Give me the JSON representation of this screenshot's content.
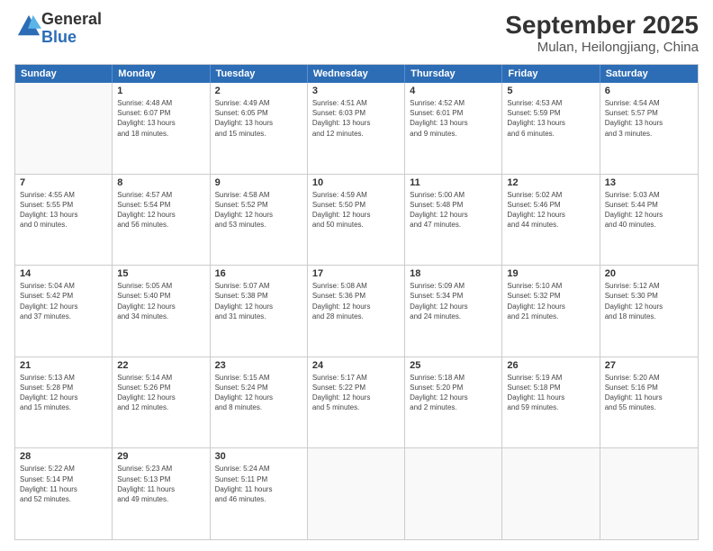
{
  "logo": {
    "general": "General",
    "blue": "Blue"
  },
  "header": {
    "month": "September 2025",
    "location": "Mulan, Heilongjiang, China"
  },
  "days": [
    "Sunday",
    "Monday",
    "Tuesday",
    "Wednesday",
    "Thursday",
    "Friday",
    "Saturday"
  ],
  "weeks": [
    [
      {
        "day": "",
        "info": ""
      },
      {
        "day": "1",
        "info": "Sunrise: 4:48 AM\nSunset: 6:07 PM\nDaylight: 13 hours\nand 18 minutes."
      },
      {
        "day": "2",
        "info": "Sunrise: 4:49 AM\nSunset: 6:05 PM\nDaylight: 13 hours\nand 15 minutes."
      },
      {
        "day": "3",
        "info": "Sunrise: 4:51 AM\nSunset: 6:03 PM\nDaylight: 13 hours\nand 12 minutes."
      },
      {
        "day": "4",
        "info": "Sunrise: 4:52 AM\nSunset: 6:01 PM\nDaylight: 13 hours\nand 9 minutes."
      },
      {
        "day": "5",
        "info": "Sunrise: 4:53 AM\nSunset: 5:59 PM\nDaylight: 13 hours\nand 6 minutes."
      },
      {
        "day": "6",
        "info": "Sunrise: 4:54 AM\nSunset: 5:57 PM\nDaylight: 13 hours\nand 3 minutes."
      }
    ],
    [
      {
        "day": "7",
        "info": "Sunrise: 4:55 AM\nSunset: 5:55 PM\nDaylight: 13 hours\nand 0 minutes."
      },
      {
        "day": "8",
        "info": "Sunrise: 4:57 AM\nSunset: 5:54 PM\nDaylight: 12 hours\nand 56 minutes."
      },
      {
        "day": "9",
        "info": "Sunrise: 4:58 AM\nSunset: 5:52 PM\nDaylight: 12 hours\nand 53 minutes."
      },
      {
        "day": "10",
        "info": "Sunrise: 4:59 AM\nSunset: 5:50 PM\nDaylight: 12 hours\nand 50 minutes."
      },
      {
        "day": "11",
        "info": "Sunrise: 5:00 AM\nSunset: 5:48 PM\nDaylight: 12 hours\nand 47 minutes."
      },
      {
        "day": "12",
        "info": "Sunrise: 5:02 AM\nSunset: 5:46 PM\nDaylight: 12 hours\nand 44 minutes."
      },
      {
        "day": "13",
        "info": "Sunrise: 5:03 AM\nSunset: 5:44 PM\nDaylight: 12 hours\nand 40 minutes."
      }
    ],
    [
      {
        "day": "14",
        "info": "Sunrise: 5:04 AM\nSunset: 5:42 PM\nDaylight: 12 hours\nand 37 minutes."
      },
      {
        "day": "15",
        "info": "Sunrise: 5:05 AM\nSunset: 5:40 PM\nDaylight: 12 hours\nand 34 minutes."
      },
      {
        "day": "16",
        "info": "Sunrise: 5:07 AM\nSunset: 5:38 PM\nDaylight: 12 hours\nand 31 minutes."
      },
      {
        "day": "17",
        "info": "Sunrise: 5:08 AM\nSunset: 5:36 PM\nDaylight: 12 hours\nand 28 minutes."
      },
      {
        "day": "18",
        "info": "Sunrise: 5:09 AM\nSunset: 5:34 PM\nDaylight: 12 hours\nand 24 minutes."
      },
      {
        "day": "19",
        "info": "Sunrise: 5:10 AM\nSunset: 5:32 PM\nDaylight: 12 hours\nand 21 minutes."
      },
      {
        "day": "20",
        "info": "Sunrise: 5:12 AM\nSunset: 5:30 PM\nDaylight: 12 hours\nand 18 minutes."
      }
    ],
    [
      {
        "day": "21",
        "info": "Sunrise: 5:13 AM\nSunset: 5:28 PM\nDaylight: 12 hours\nand 15 minutes."
      },
      {
        "day": "22",
        "info": "Sunrise: 5:14 AM\nSunset: 5:26 PM\nDaylight: 12 hours\nand 12 minutes."
      },
      {
        "day": "23",
        "info": "Sunrise: 5:15 AM\nSunset: 5:24 PM\nDaylight: 12 hours\nand 8 minutes."
      },
      {
        "day": "24",
        "info": "Sunrise: 5:17 AM\nSunset: 5:22 PM\nDaylight: 12 hours\nand 5 minutes."
      },
      {
        "day": "25",
        "info": "Sunrise: 5:18 AM\nSunset: 5:20 PM\nDaylight: 12 hours\nand 2 minutes."
      },
      {
        "day": "26",
        "info": "Sunrise: 5:19 AM\nSunset: 5:18 PM\nDaylight: 11 hours\nand 59 minutes."
      },
      {
        "day": "27",
        "info": "Sunrise: 5:20 AM\nSunset: 5:16 PM\nDaylight: 11 hours\nand 55 minutes."
      }
    ],
    [
      {
        "day": "28",
        "info": "Sunrise: 5:22 AM\nSunset: 5:14 PM\nDaylight: 11 hours\nand 52 minutes."
      },
      {
        "day": "29",
        "info": "Sunrise: 5:23 AM\nSunset: 5:13 PM\nDaylight: 11 hours\nand 49 minutes."
      },
      {
        "day": "30",
        "info": "Sunrise: 5:24 AM\nSunset: 5:11 PM\nDaylight: 11 hours\nand 46 minutes."
      },
      {
        "day": "",
        "info": ""
      },
      {
        "day": "",
        "info": ""
      },
      {
        "day": "",
        "info": ""
      },
      {
        "day": "",
        "info": ""
      }
    ]
  ]
}
